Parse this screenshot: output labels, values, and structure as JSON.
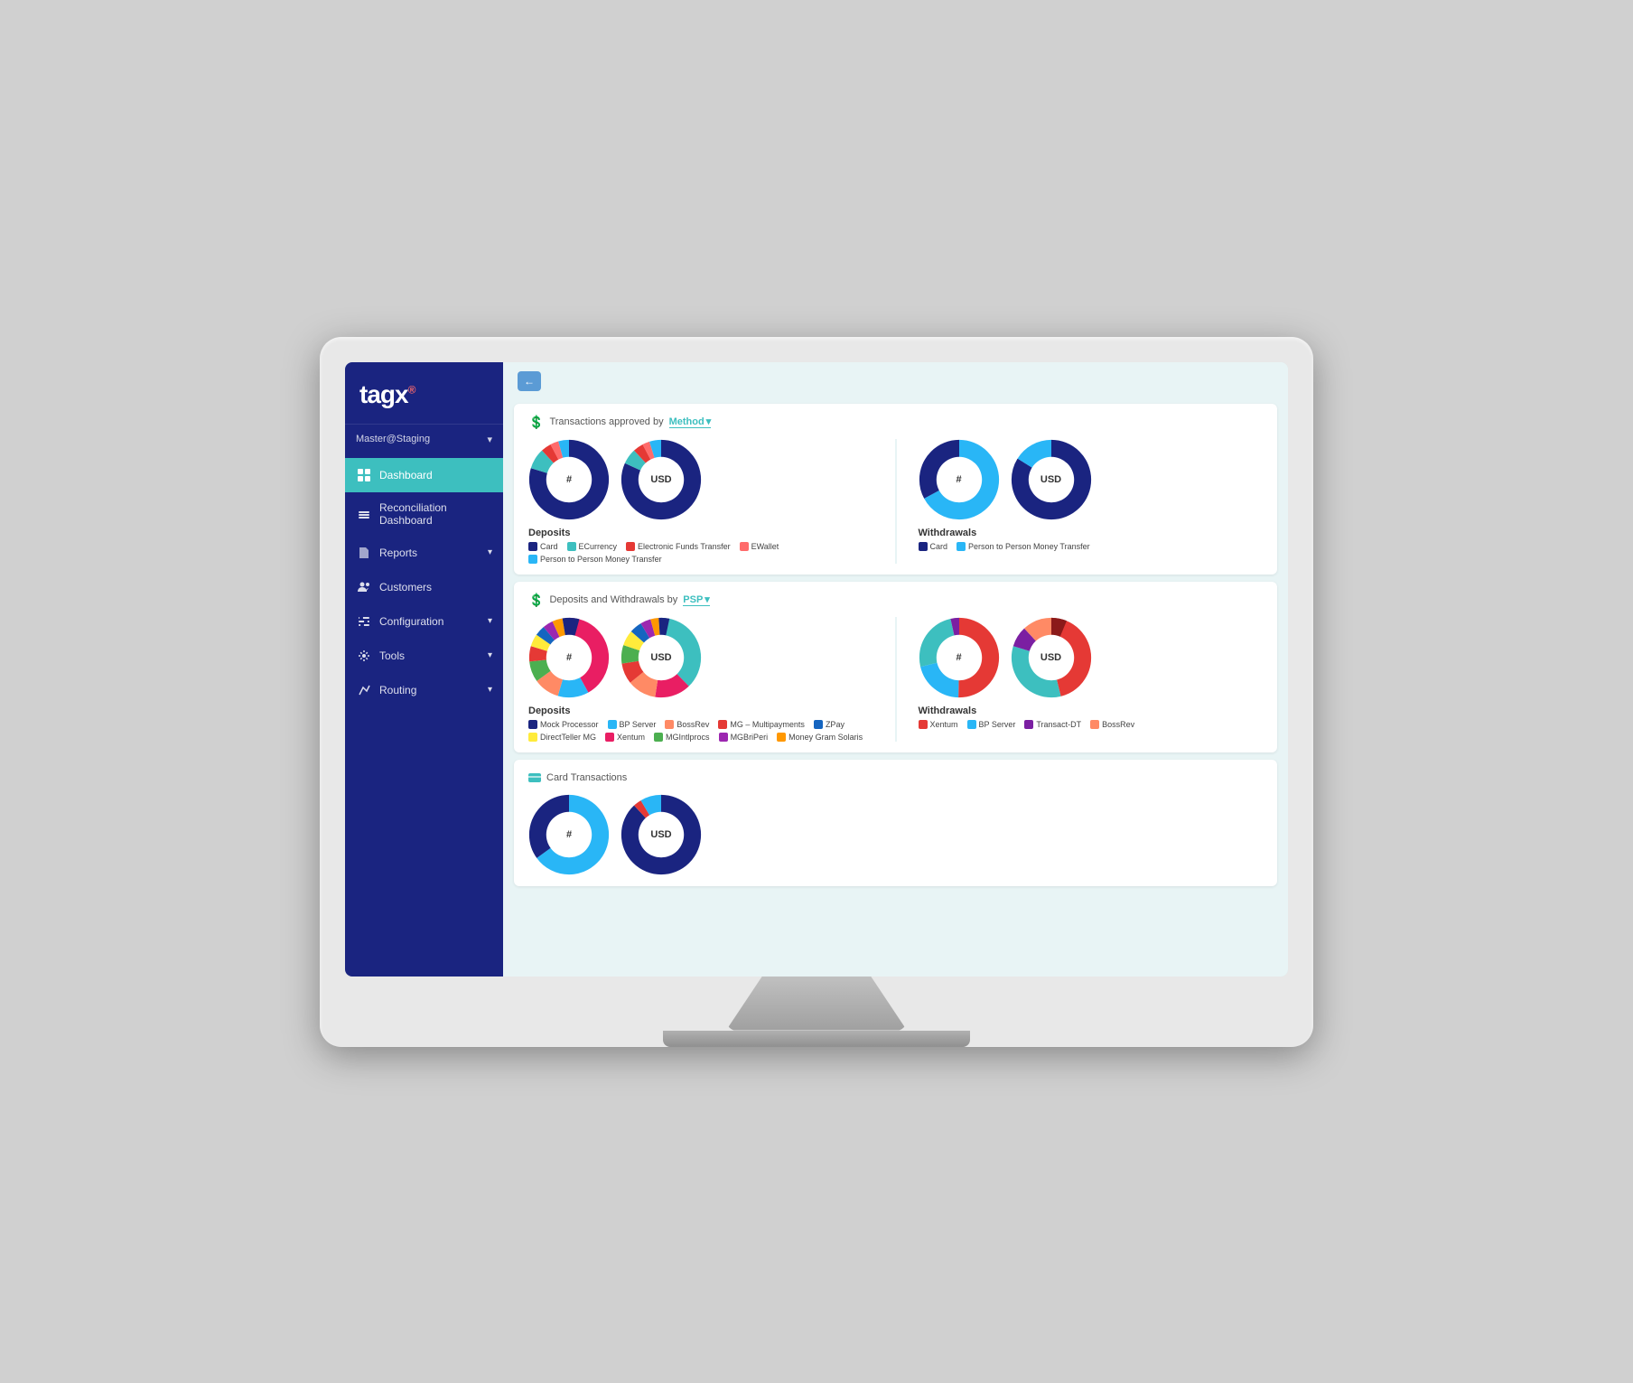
{
  "app": {
    "name": "tagx",
    "registered_symbol": "®"
  },
  "sidebar": {
    "account": "Master@Staging",
    "items": [
      {
        "id": "dashboard",
        "label": "Dashboard",
        "active": true,
        "icon": "grid"
      },
      {
        "id": "reconciliation",
        "label": "Reconciliation Dashboard",
        "active": false,
        "icon": "layers"
      },
      {
        "id": "reports",
        "label": "Reports",
        "active": false,
        "icon": "file",
        "has_arrow": true
      },
      {
        "id": "customers",
        "label": "Customers",
        "active": false,
        "icon": "users"
      },
      {
        "id": "configuration",
        "label": "Configuration",
        "active": false,
        "icon": "sliders",
        "has_arrow": true
      },
      {
        "id": "tools",
        "label": "Tools",
        "active": false,
        "icon": "wrench",
        "has_arrow": true
      },
      {
        "id": "routing",
        "label": "Routing",
        "active": false,
        "icon": "route",
        "has_arrow": true
      }
    ]
  },
  "header": {
    "back_button": "←"
  },
  "cards": [
    {
      "id": "transactions-approved",
      "icon": "$",
      "title": "Transactions approved by",
      "selector": "Method",
      "deposits_title": "Deposits",
      "withdrawals_title": "Withdrawals",
      "deposits_legend": [
        {
          "label": "Card",
          "color": "#1a2480"
        },
        {
          "label": "ECurrency",
          "color": "#3dbfbf"
        },
        {
          "label": "Electronic Funds Transfer",
          "color": "#e53935"
        },
        {
          "label": "EWallet",
          "color": "#ff6b6b"
        },
        {
          "label": "Person to Person Money Transfer",
          "color": "#29b6f6"
        }
      ],
      "withdrawals_legend": [
        {
          "label": "Card",
          "color": "#1a2480"
        },
        {
          "label": "Person to Person Money Transfer",
          "color": "#29b6f6"
        }
      ]
    },
    {
      "id": "deposits-withdrawals-psp",
      "icon": "$",
      "title": "Deposits and Withdrawals by",
      "selector": "PSP",
      "deposits_title": "Deposits",
      "withdrawals_title": "Withdrawals",
      "deposits_legend": [
        {
          "label": "Mock Processor",
          "color": "#1a2480"
        },
        {
          "label": "BP Server",
          "color": "#29b6f6"
        },
        {
          "label": "BossRev",
          "color": "#ff8a65"
        },
        {
          "label": "MG – Multipayments",
          "color": "#e53935"
        },
        {
          "label": "ZPay",
          "color": "#1565c0"
        },
        {
          "label": "DirectTeller MG",
          "color": "#ffeb3b"
        },
        {
          "label": "Xentum",
          "color": "#e91e63"
        },
        {
          "label": "MGIntlprocs",
          "color": "#4caf50"
        },
        {
          "label": "MGBriPeri",
          "color": "#9c27b0"
        },
        {
          "label": "Money Gram Solaris",
          "color": "#ff9800"
        }
      ],
      "withdrawals_legend": [
        {
          "label": "Xentum",
          "color": "#e53935"
        },
        {
          "label": "BP Server",
          "color": "#29b6f6"
        },
        {
          "label": "Transact-DT",
          "color": "#7b1fa2"
        },
        {
          "label": "BossRev",
          "color": "#ff8a65"
        }
      ]
    },
    {
      "id": "card-transactions",
      "icon": "card",
      "title": "Card Transactions"
    }
  ]
}
